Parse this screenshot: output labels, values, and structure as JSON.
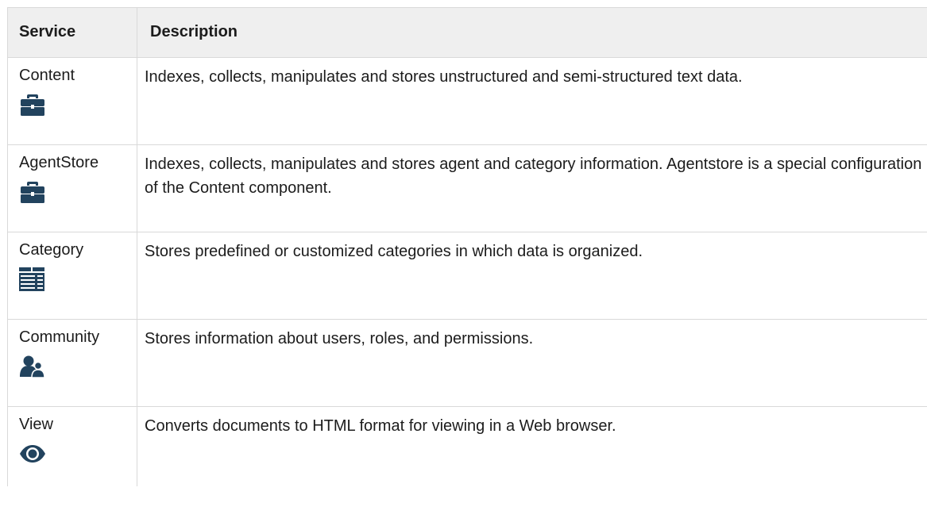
{
  "table": {
    "headers": {
      "service": "Service",
      "description": "Description"
    },
    "rows": [
      {
        "service": "Content",
        "icon": "briefcase-icon",
        "description": "Indexes, collects, manipulates and stores unstructured and semi-structured text data."
      },
      {
        "service": "AgentStore",
        "icon": "briefcase-icon",
        "description": "Indexes, collects, manipulates and stores agent and category information. Agentstore is a special configuration of the Content component."
      },
      {
        "service": "Category",
        "icon": "category-list-icon",
        "description": "Stores predefined or customized categories in which data is organized."
      },
      {
        "service": "Community",
        "icon": "users-icon",
        "description": "Stores information about users, roles, and permissions."
      },
      {
        "service": "View",
        "icon": "eye-icon",
        "description": "Converts documents to HTML format for viewing in a Web browser."
      }
    ]
  },
  "colors": {
    "icon": "#22435e",
    "header_bg": "#efefef",
    "border": "#d9d9d9"
  }
}
